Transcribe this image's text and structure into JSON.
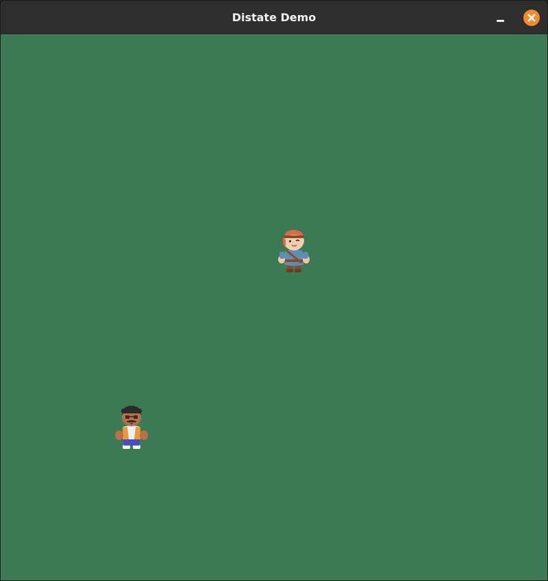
{
  "window": {
    "title": "Distate Demo"
  },
  "colors": {
    "titlebar_bg": "#2e2e2e",
    "game_bg": "#3c7a55",
    "close_button": "#f08a2c"
  },
  "titlebar_buttons": [
    "minimize-icon",
    "close-icon"
  ],
  "scene": {
    "characters": [
      {
        "name": "adventurer",
        "description_icon": "red-haired-character-sprite"
      },
      {
        "name": "villager",
        "description_icon": "mustached-character-sprite"
      }
    ]
  }
}
